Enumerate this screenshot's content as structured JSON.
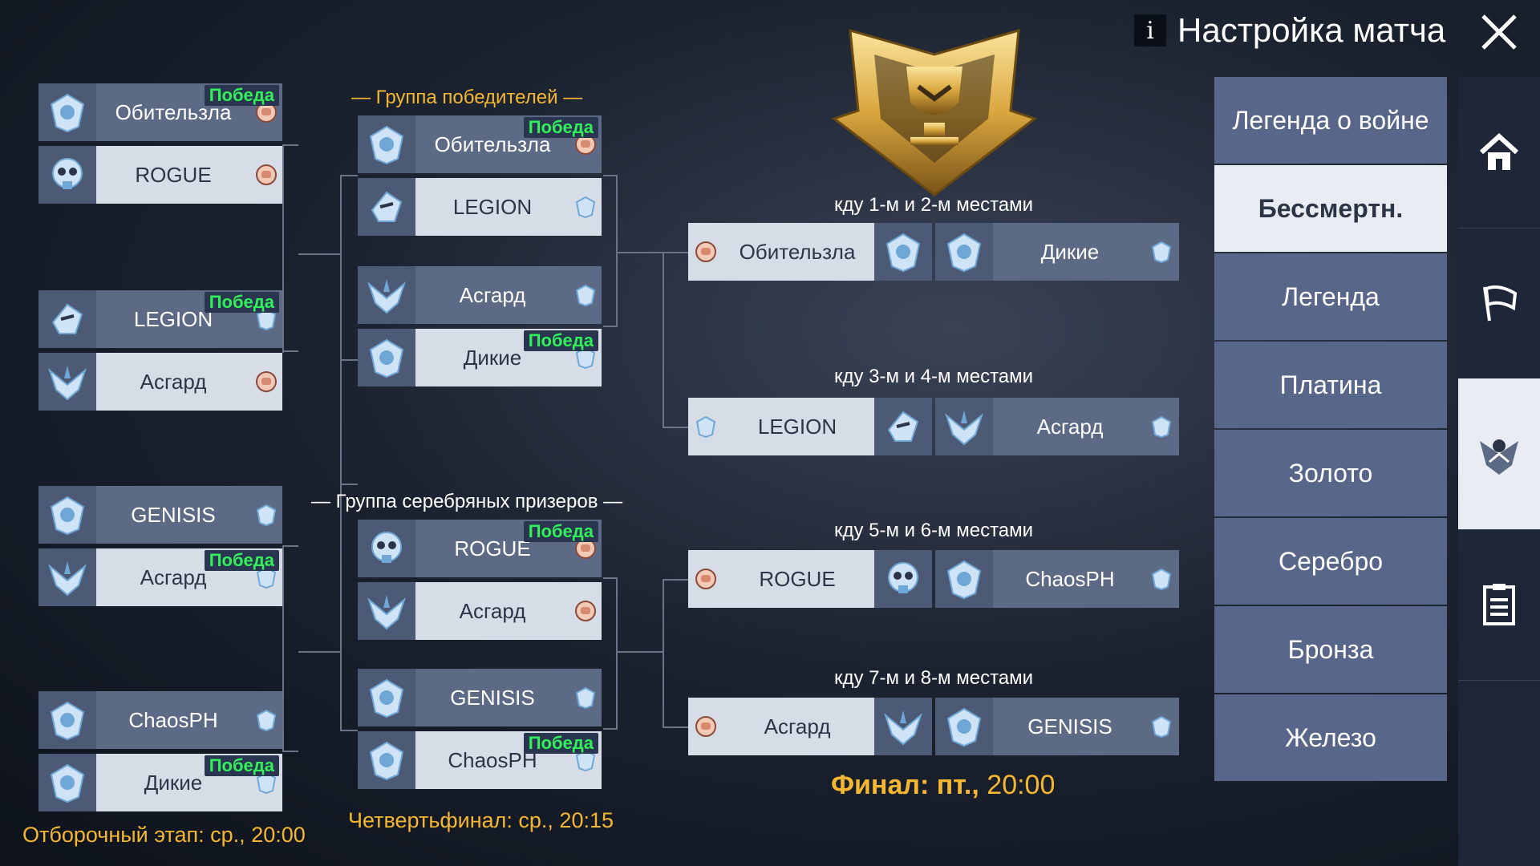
{
  "header": {
    "title": "Настройка матча",
    "info": "i"
  },
  "badge_text": "Победа",
  "qualifier": {
    "label": "Отборочный этап: ср.,",
    "time": "20:00",
    "matches": [
      {
        "top": {
          "name": "Обительзла",
          "win": true
        },
        "bottom": {
          "name": "ROGUE",
          "win": false
        }
      },
      {
        "top": {
          "name": "LEGION",
          "win": true
        },
        "bottom": {
          "name": "Асгард",
          "win": false
        }
      },
      {
        "top": {
          "name": "GENISIS",
          "win": false
        },
        "bottom": {
          "name": "Асгард",
          "win": true
        }
      },
      {
        "top": {
          "name": "ChaosPH",
          "win": false
        },
        "bottom": {
          "name": "Дикие",
          "win": true
        }
      }
    ]
  },
  "quarter": {
    "label": "Четвертьфинал: ср.,",
    "time": "20:15",
    "winners_group": "— Группа победителей —",
    "silver_group": "— Группа серебряных призеров —",
    "winners_matches": [
      {
        "top": {
          "name": "Обительзла",
          "win": true
        },
        "bottom": {
          "name": "LEGION",
          "win": false
        }
      },
      {
        "top": {
          "name": "Асгард",
          "win": false
        },
        "bottom": {
          "name": "Дикие",
          "win": true
        }
      }
    ],
    "silver_matches": [
      {
        "top": {
          "name": "ROGUE",
          "win": true
        },
        "bottom": {
          "name": "Асгард",
          "win": false
        }
      },
      {
        "top": {
          "name": "GENISIS",
          "win": false
        },
        "bottom": {
          "name": "ChaosPH",
          "win": true
        }
      }
    ]
  },
  "final": {
    "label": "Финал: пт.,",
    "time": "20:00",
    "matches": [
      {
        "title": "кду 1-м и 2-м местами",
        "left": "Обительзла",
        "right": "Дикие"
      },
      {
        "title": "кду 3-м и 4-м местами",
        "left": "LEGION",
        "right": "Асгард"
      },
      {
        "title": "кду 5-м и 6-м местами",
        "left": "ROGUE",
        "right": "ChaosPH"
      },
      {
        "title": "кду 7-м и 8-м местами",
        "left": "Асгард",
        "right": "GENISIS"
      }
    ]
  },
  "tiers": [
    "Легенда о войне",
    "Бессмертн.",
    "Легенда",
    "Платина",
    "Золото",
    "Серебро",
    "Бронза",
    "Железо"
  ],
  "active_tier": 1,
  "colors": {
    "accent": "#f5b731",
    "win": "#32f05a",
    "cell_light": "#d7dde7",
    "cell_dark": "#5d6a85"
  }
}
